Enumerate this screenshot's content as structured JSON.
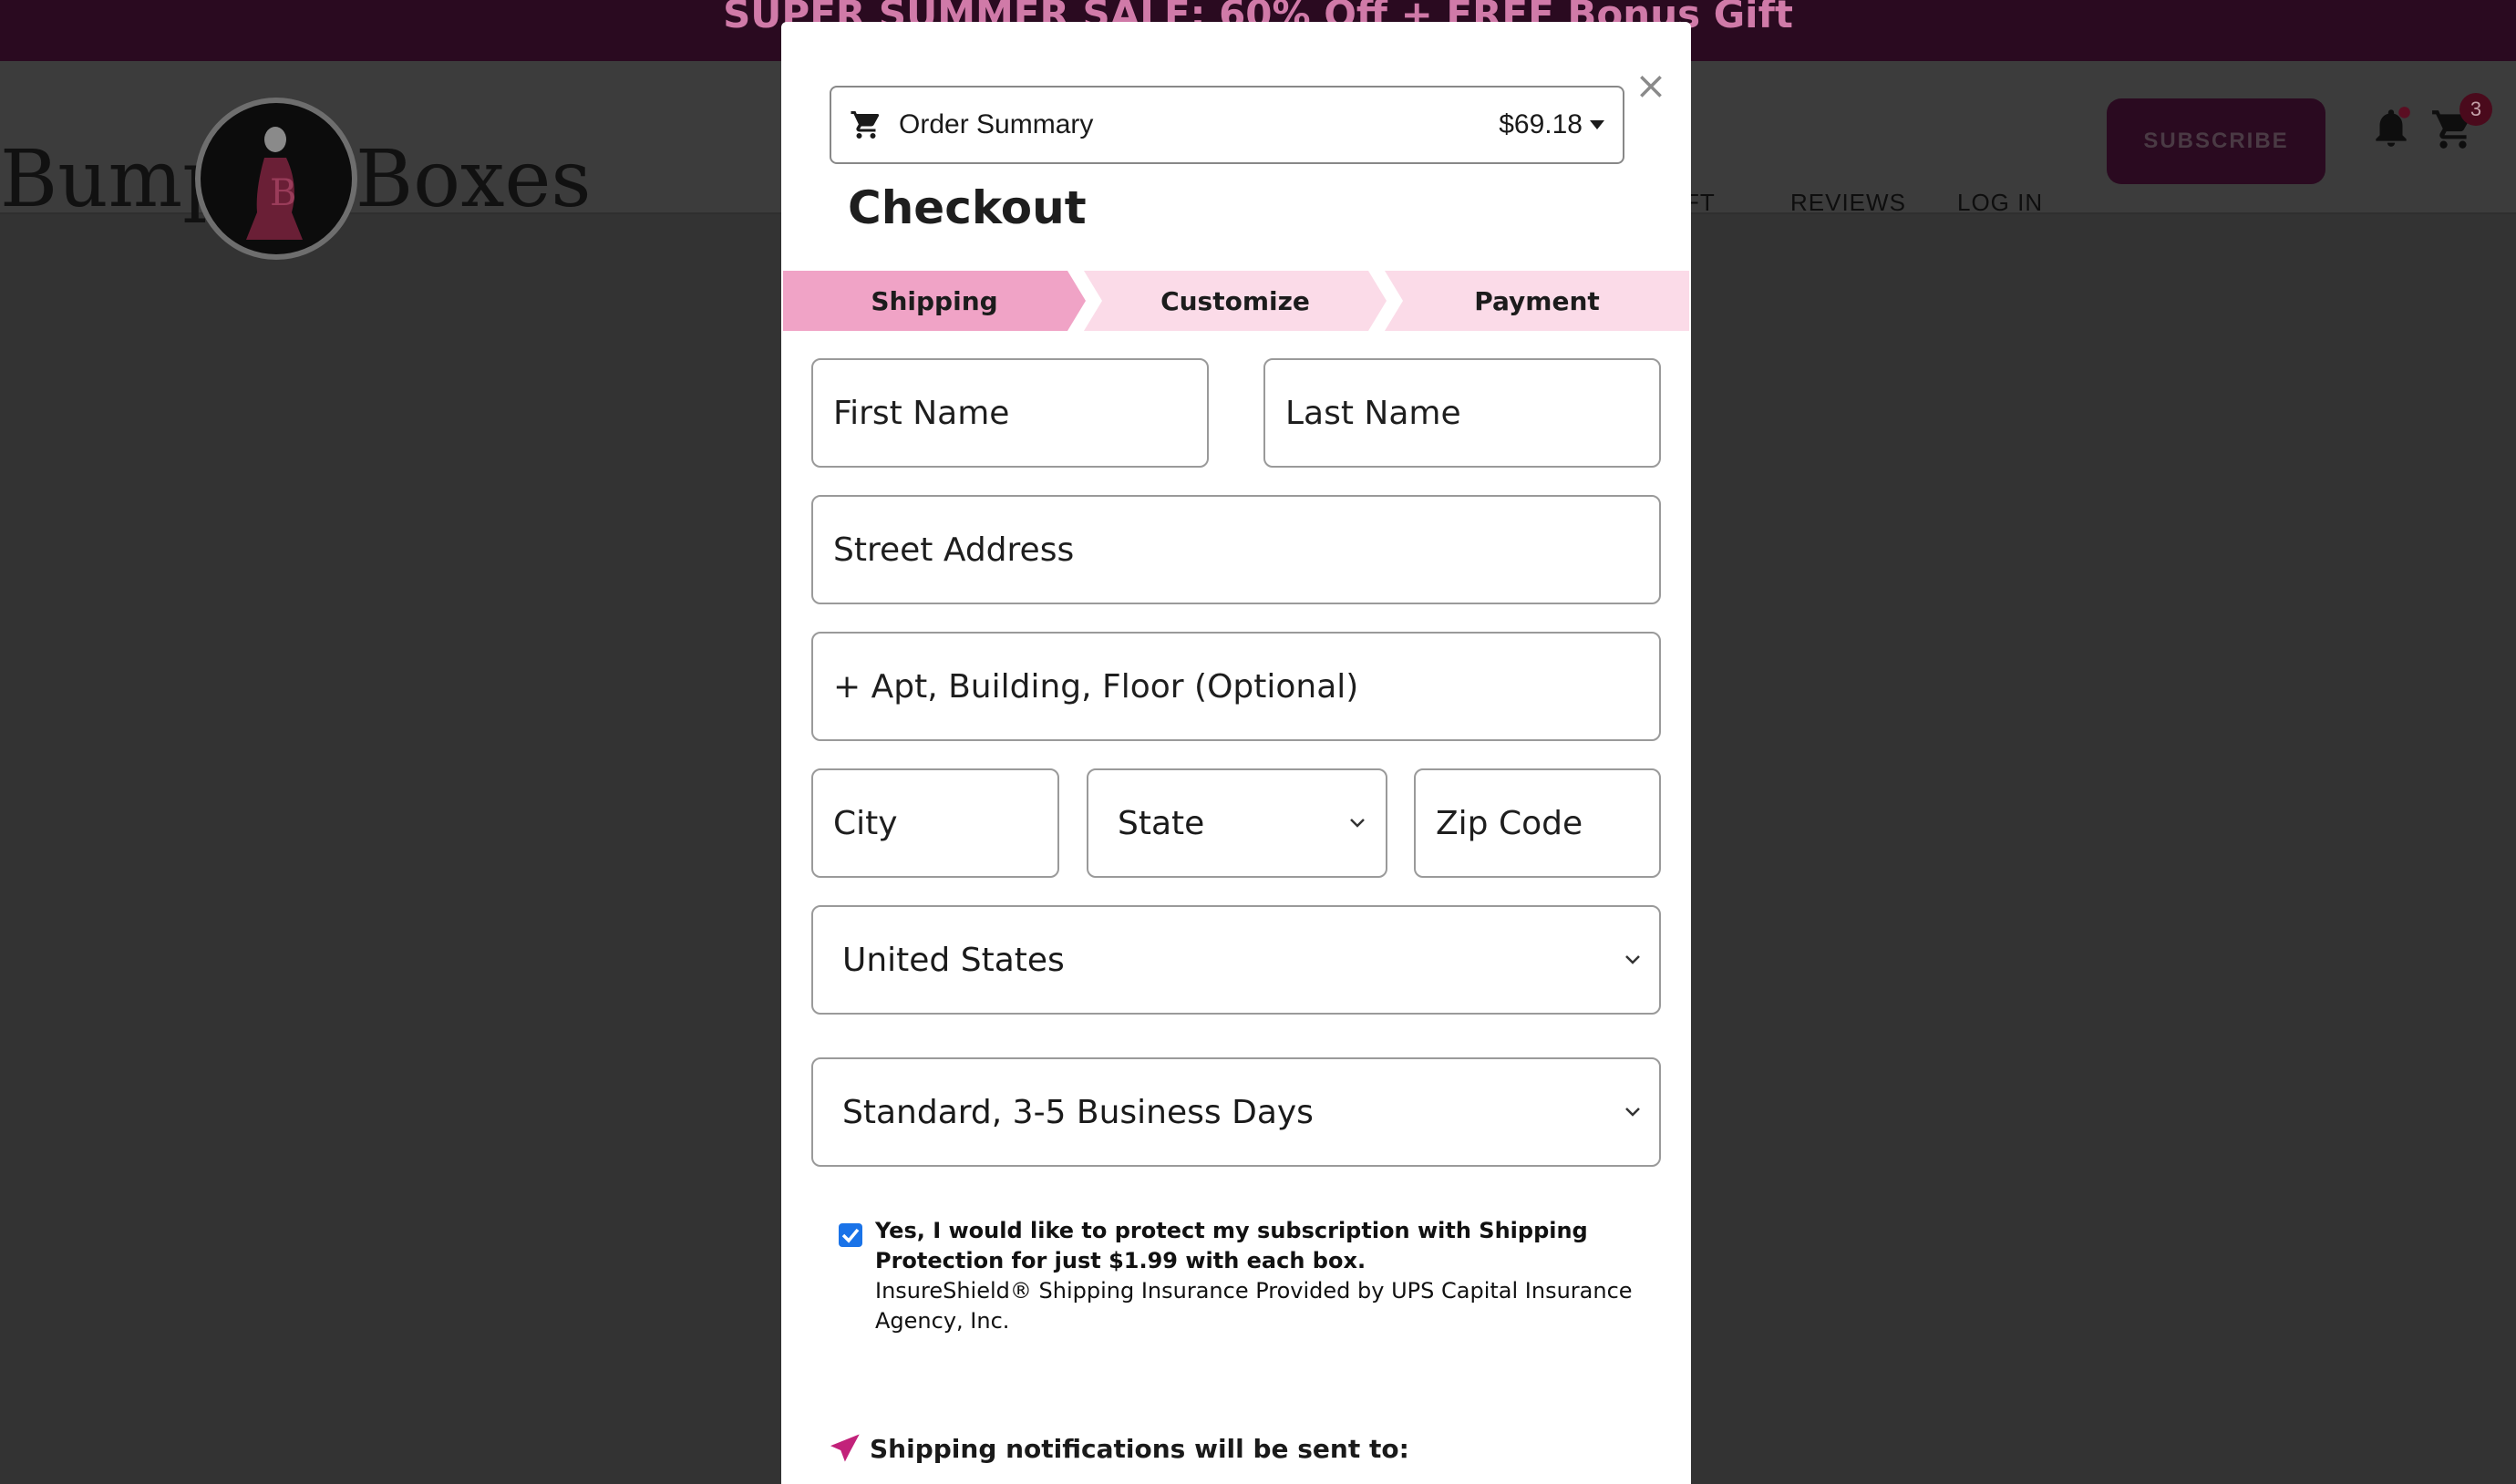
{
  "promo": {
    "text": "SUPER SUMMER SALE: 60% Off + FREE Bonus Gift"
  },
  "site": {
    "logo_left": "Bump",
    "logo_right": "Boxes",
    "nav": [
      "FT",
      "REVIEWS",
      "LOG IN"
    ],
    "subscribe_label": "SUBSCRIBE",
    "cart_count": "3"
  },
  "modal": {
    "close_label": "×",
    "order_summary": {
      "label": "Order Summary",
      "amount": "$69.18"
    },
    "title": "Checkout",
    "steps": [
      {
        "label": "Shipping",
        "active": true
      },
      {
        "label": "Customize",
        "active": false
      },
      {
        "label": "Payment",
        "active": false
      }
    ],
    "fields": {
      "first_name": {
        "placeholder": "First Name"
      },
      "last_name": {
        "placeholder": "Last Name"
      },
      "street": {
        "placeholder": "Street Address"
      },
      "apt": {
        "placeholder": "+ Apt, Building, Floor (Optional)"
      },
      "city": {
        "placeholder": "City"
      },
      "state": {
        "value": "State"
      },
      "zip": {
        "placeholder": "Zip Code"
      },
      "country": {
        "value": "United States"
      },
      "shipping_method": {
        "value": "Standard, 3-5 Business Days"
      }
    },
    "protection": {
      "checked": true,
      "bold_text": "Yes, I would like to protect my subscription with Shipping Protection for just $1.99 with each box.",
      "sub_text": "InsureShield® Shipping Insurance Provided by UPS Capital Insurance Agency, Inc."
    },
    "notifications": {
      "label": "Shipping notifications will be sent to:"
    }
  },
  "colors": {
    "overlay": "#333333",
    "step_active": "#f0a3c6",
    "step_inactive": "#fbdbe8",
    "checkbox": "#1a73e8",
    "plane_icon": "#c2227a",
    "brand_dark": "#2a0a20"
  }
}
